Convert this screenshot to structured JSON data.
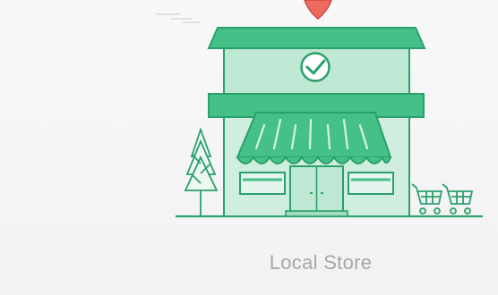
{
  "caption": {
    "label": "Local Store"
  },
  "colors": {
    "background": "#f6f6f7",
    "primary_green": "#45c089",
    "light_green": "#bfe8d4",
    "pale_green": "#d9f1e5",
    "line_green": "#2aa06a",
    "marker_red": "#ee6a5e",
    "caption_gray": "#a7a7aa"
  },
  "icons": {
    "map_marker": "map-pin-icon",
    "check": "check-circle-icon",
    "tree": "tree-icon",
    "cart": "shopping-cart-icon"
  }
}
